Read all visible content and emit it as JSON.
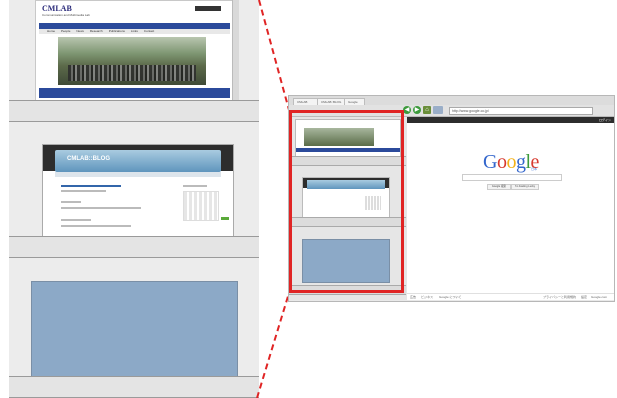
{
  "zoom": {
    "cmlab": {
      "logo": "CMLAB",
      "subtitle": "Communication and Multimedia Lab",
      "menu": [
        "Home",
        "People",
        "News",
        "Research",
        "Publications",
        "Links",
        "Contact"
      ]
    },
    "blog": {
      "title": "CMLAB::BLOG",
      "menu": [
        "Home",
        "Archives",
        "About"
      ]
    }
  },
  "browser": {
    "tabs": [
      "CMLAB",
      "CMLAB::BLOG",
      "Google"
    ],
    "url": "http://www.google.co.jp/",
    "google_bar": [
      "ウェブ",
      "画像",
      "動画",
      "地図",
      "ニュース",
      "翻訳",
      "Gmail",
      "その他"
    ],
    "google_bar_right": "ログイン",
    "logo_letters": [
      "G",
      "o",
      "o",
      "g",
      "l",
      "e"
    ],
    "logo_colors": [
      "#3366cc",
      "#d73a2f",
      "#f3b21a",
      "#3366cc",
      "#3b9a3b",
      "#d73a2f"
    ],
    "logo_sub": "日本",
    "search_button": "Google 検索",
    "lucky_button": "I'm Feeling Lucky",
    "footer_left": [
      "広告",
      "ビジネス",
      "Google について"
    ],
    "footer_right": [
      "プライバシーと利用規約",
      "設定",
      "Google.com"
    ]
  },
  "colors": {
    "highlight": "#e02424",
    "blank_thumb": "#8ca9c7"
  }
}
